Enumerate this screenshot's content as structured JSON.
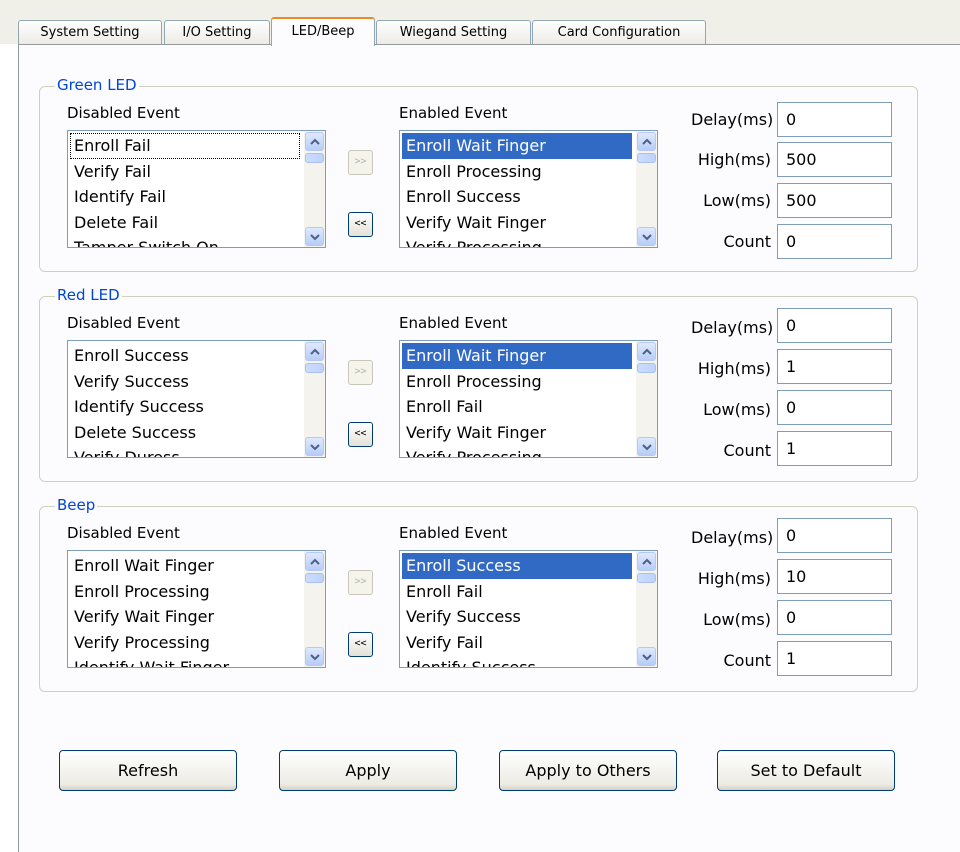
{
  "tabs": [
    {
      "label": "System Setting"
    },
    {
      "label": "I/O Setting"
    },
    {
      "label": "LED/Beep"
    },
    {
      "label": "Wiegand Setting"
    },
    {
      "label": "Card Configuration"
    }
  ],
  "active_tab": "LED/Beep",
  "groups": [
    {
      "title": "Green LED",
      "disabled_label": "Disabled Event",
      "enabled_label": "Enabled Event",
      "disabled_events": [
        "Enroll Fail",
        "Verify Fail",
        "Identify Fail",
        "Delete Fail",
        "Tamper Switch On"
      ],
      "enabled_events": [
        "Enroll Wait Finger",
        "Enroll Processing",
        "Enroll Success",
        "Verify Wait Finger",
        "Verify Processing"
      ],
      "delay_label": "Delay(ms)",
      "delay": "0",
      "high_label": "High(ms)",
      "high": "500",
      "low_label": "Low(ms)",
      "low": "500",
      "count_label": "Count",
      "count": "0"
    },
    {
      "title": "Red LED",
      "disabled_label": "Disabled Event",
      "enabled_label": "Enabled Event",
      "disabled_events": [
        "Enroll Success",
        "Verify Success",
        "Identify Success",
        "Delete Success",
        "Verify Duress"
      ],
      "enabled_events": [
        "Enroll Wait Finger",
        "Enroll Processing",
        "Enroll Fail",
        "Verify Wait Finger",
        "Verify Processing"
      ],
      "delay_label": "Delay(ms)",
      "delay": "0",
      "high_label": "High(ms)",
      "high": "1",
      "low_label": "Low(ms)",
      "low": "0",
      "count_label": "Count",
      "count": "1"
    },
    {
      "title": "Beep",
      "disabled_label": "Disabled Event",
      "enabled_label": "Enabled Event",
      "disabled_events": [
        "Enroll Wait Finger",
        "Enroll Processing",
        "Verify Wait Finger",
        "Verify Processing",
        "Identify Wait Finger"
      ],
      "enabled_events": [
        "Enroll Success",
        "Enroll Fail",
        "Verify Success",
        "Verify Fail",
        "Identify Success"
      ],
      "delay_label": "Delay(ms)",
      "delay": "0",
      "high_label": "High(ms)",
      "high": "10",
      "low_label": "Low(ms)",
      "low": "0",
      "count_label": "Count",
      "count": "1"
    }
  ],
  "move_buttons": {
    "add": ">>",
    "remove": "<<"
  },
  "actions": {
    "refresh": "Refresh",
    "apply": "Apply",
    "apply_others": "Apply to Others",
    "set_default": "Set to Default"
  },
  "colors": {
    "group_title": "#0046d5",
    "selection": "#316ac5",
    "active_tab_accent": "#e68b2c"
  }
}
